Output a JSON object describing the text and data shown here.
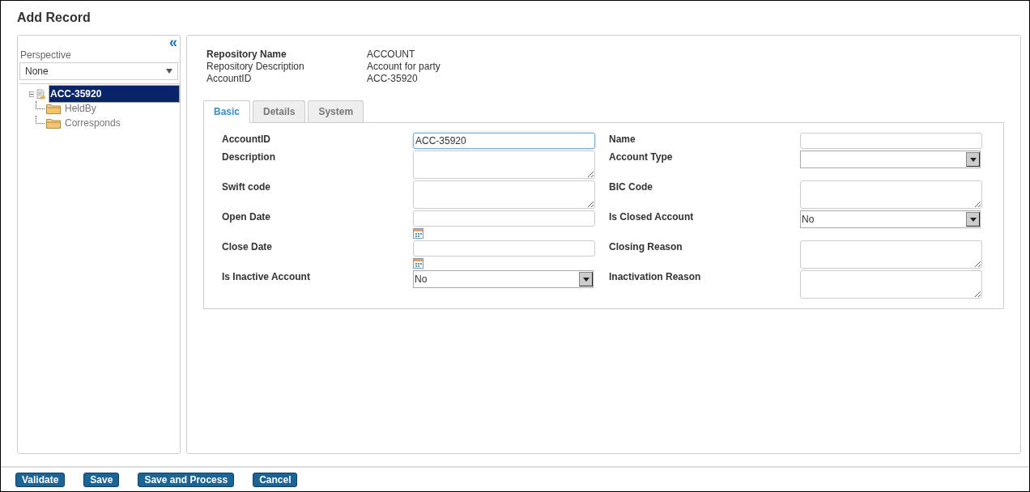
{
  "window": {
    "title": "Add Record"
  },
  "sidebar": {
    "collapse_icon": "«",
    "perspective": {
      "label": "Perspective",
      "value": "None"
    },
    "tree": [
      {
        "label": "ACC-35920",
        "selected": true,
        "expanded": true,
        "children": [
          {
            "label": "HeldBy",
            "selected": false
          },
          {
            "label": "Corresponds",
            "selected": false
          }
        ]
      }
    ]
  },
  "info": [
    {
      "label": "Repository Name",
      "value": "ACCOUNT",
      "bold": true
    },
    {
      "label": "Repository Description",
      "value": "Account for party",
      "bold": false
    },
    {
      "label": "AccountID",
      "value": "ACC-35920",
      "bold": false
    }
  ],
  "tabs": [
    {
      "label": "Basic",
      "selected": true
    },
    {
      "label": "Details",
      "selected": false
    },
    {
      "label": "System",
      "selected": false
    }
  ],
  "form_rows": [
    [
      {
        "label": "AccountID",
        "kind": "text",
        "value": "ACC-35920",
        "focused": true
      },
      {
        "label": "Name",
        "kind": "text",
        "focused": false
      }
    ],
    [
      {
        "label": "Description",
        "kind": "textarea",
        "focused": false
      },
      {
        "label": "Account Type",
        "kind": "select",
        "focused": false
      }
    ],
    [
      {
        "label": "Swift code",
        "kind": "textarea",
        "focused": false
      },
      {
        "label": "BIC Code",
        "kind": "textarea",
        "focused": false
      }
    ],
    [
      {
        "label": "Open Date",
        "kind": "date",
        "focused": false
      },
      {
        "label": "Is Closed Account",
        "kind": "select",
        "value": "No",
        "focused": false
      }
    ],
    [
      {
        "label": "Close Date",
        "kind": "date",
        "focused": false
      },
      {
        "label": "Closing Reason",
        "kind": "textarea",
        "focused": false
      }
    ],
    [
      {
        "label": "Is Inactive Account",
        "kind": "select",
        "value": "No",
        "focused": false
      },
      {
        "label": "Inactivation Reason",
        "kind": "textarea",
        "focused": false
      }
    ]
  ],
  "buttons": [
    "Validate",
    "Save",
    "Save and Process",
    "Cancel"
  ]
}
